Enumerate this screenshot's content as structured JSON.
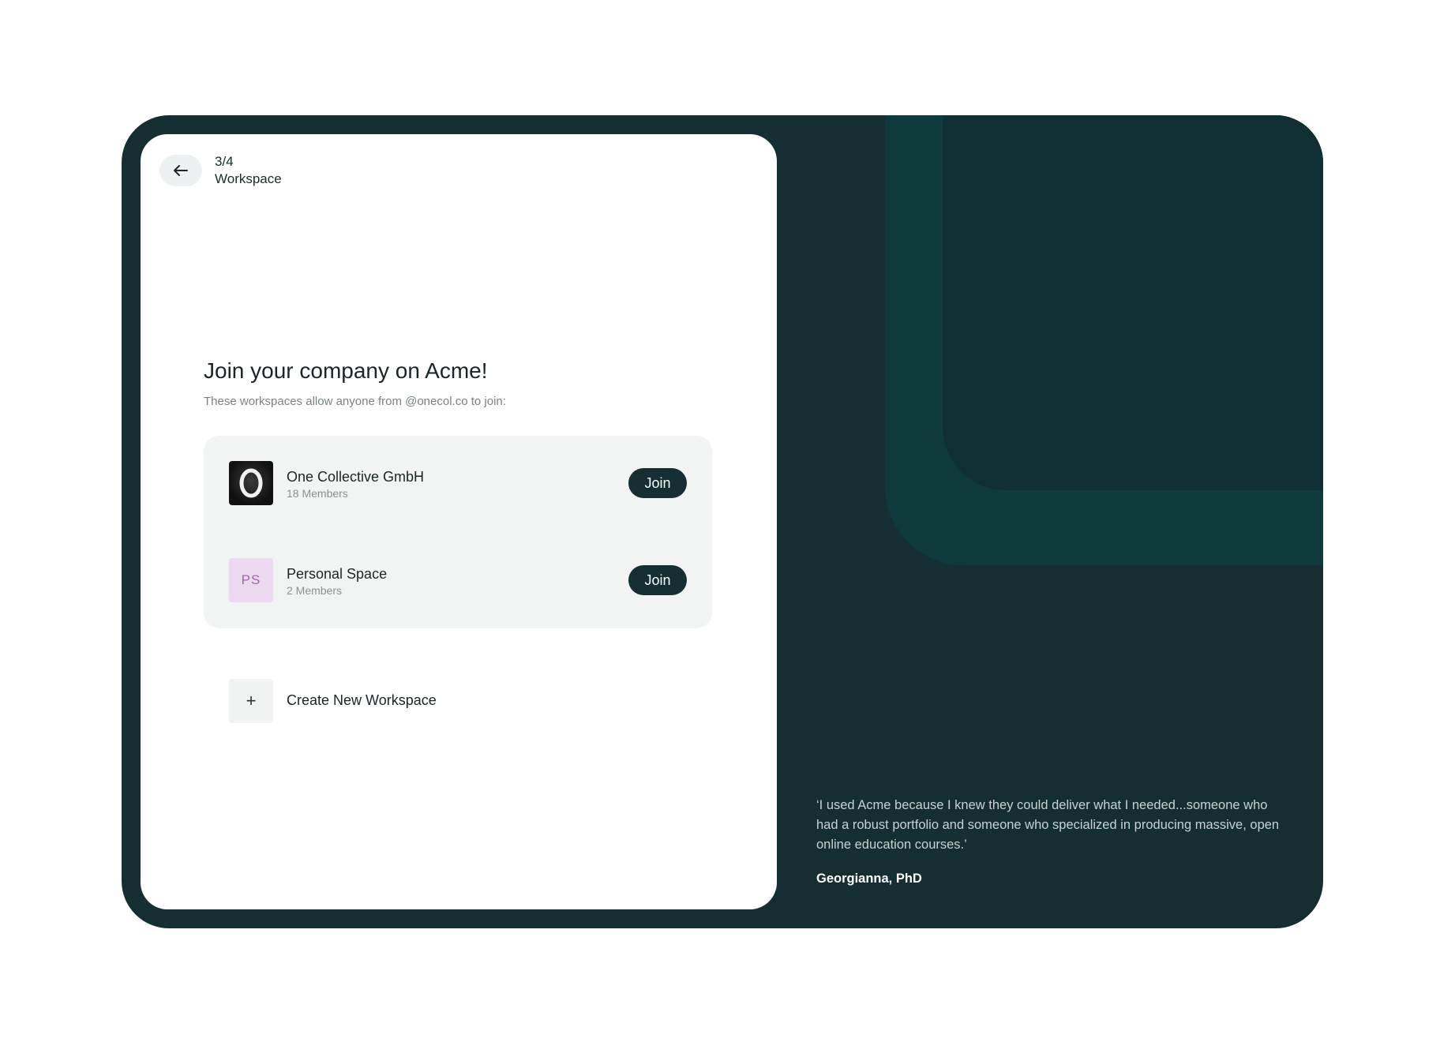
{
  "step": {
    "progress": "3/4",
    "label": "Workspace"
  },
  "back_icon": "arrow-left-icon",
  "heading": "Join your company on Acme!",
  "subheading": "These workspaces allow anyone from @onecol.co to join:",
  "workspaces": [
    {
      "name": "One Collective GmbH",
      "members": "18 Members",
      "logo": "O",
      "action": "Join"
    },
    {
      "name": "Personal Space",
      "members": "2 Members",
      "logo": "PS",
      "action": "Join"
    }
  ],
  "create": {
    "icon": "+",
    "label": "Create New Workspace"
  },
  "testimonial": {
    "quote": "‘I used Acme because I knew they could deliver what I needed...someone who had a robust portfolio and someone who specialized in producing massive, open online education courses.’",
    "author": "Georgianna, PhD"
  },
  "colors": {
    "brand_dark": "#142e31",
    "accent_teal": "#0f3a3c",
    "card_bg": "#ffffff",
    "list_bg": "#f1f4f3",
    "ps_logo_bg": "#ecdaf0"
  }
}
